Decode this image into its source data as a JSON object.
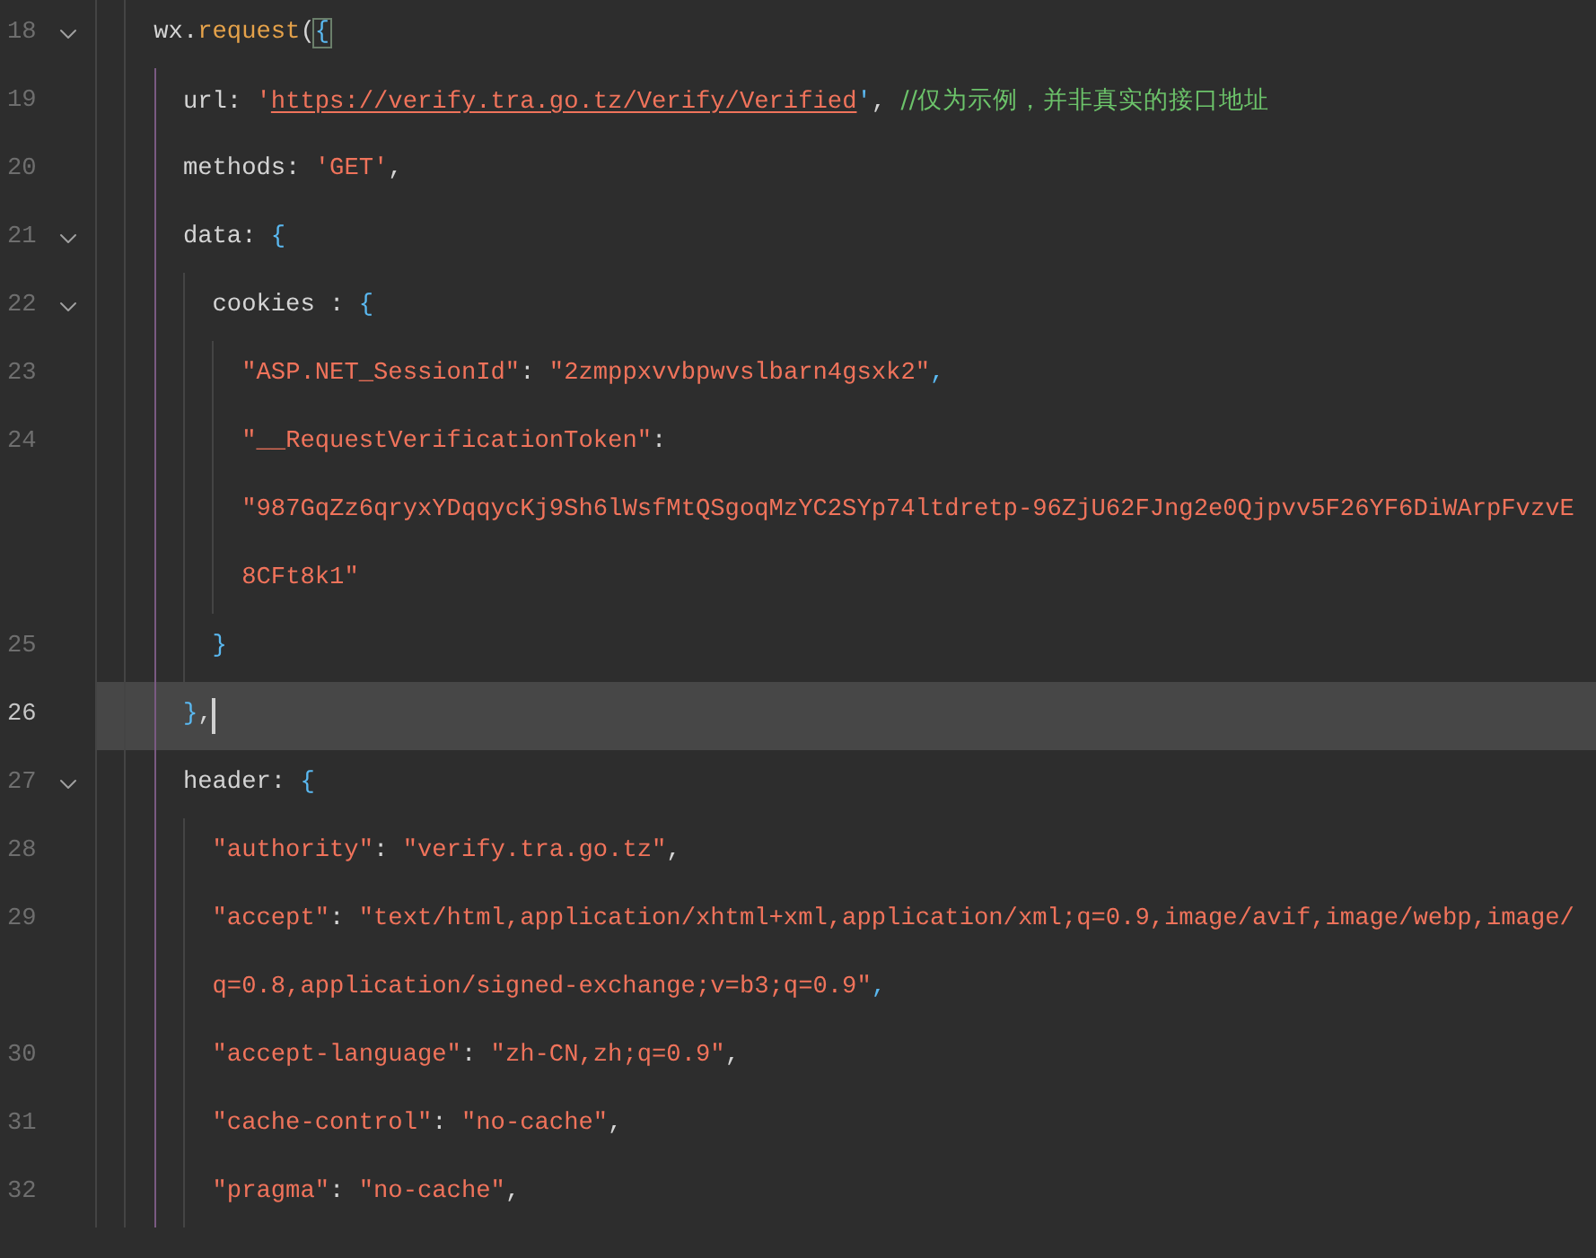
{
  "editor": {
    "lines": [
      {
        "number": "18",
        "foldable": true,
        "current": false,
        "tokens": [
          {
            "kind": "plain",
            "text": "wx."
          },
          {
            "kind": "func",
            "text": "request"
          },
          {
            "kind": "plain",
            "text": "("
          },
          {
            "kind": "matched-brace",
            "text": "{"
          }
        ],
        "children": [
          {
            "number": "19",
            "foldable": false,
            "current": false,
            "tokens": [
              {
                "kind": "plain",
                "text": "url: "
              },
              {
                "kind": "string",
                "text": "'"
              },
              {
                "kind": "link",
                "text": "https://verify.tra.go.tz/Verify/Verified"
              },
              {
                "kind": "brace",
                "text": "'"
              },
              {
                "kind": "plain",
                "text": ", "
              },
              {
                "kind": "comment",
                "text": "//仅为示例，并非真实的接口地址"
              }
            ]
          },
          {
            "number": "20",
            "foldable": false,
            "current": false,
            "tokens": [
              {
                "kind": "plain",
                "text": "methods: "
              },
              {
                "kind": "string",
                "text": "'GET'"
              },
              {
                "kind": "plain",
                "text": ","
              }
            ]
          },
          {
            "number": "21",
            "foldable": true,
            "current": false,
            "tokens": [
              {
                "kind": "plain",
                "text": "data: "
              },
              {
                "kind": "brace",
                "text": "{"
              }
            ],
            "children": [
              {
                "number": "22",
                "foldable": true,
                "current": false,
                "tokens": [
                  {
                    "kind": "plain",
                    "text": "cookies : "
                  },
                  {
                    "kind": "brace",
                    "text": "{"
                  }
                ],
                "children": [
                  {
                    "number": "23",
                    "foldable": false,
                    "current": false,
                    "tokens": [
                      {
                        "kind": "string",
                        "text": "\"ASP.NET_SessionId\""
                      },
                      {
                        "kind": "plain",
                        "text": ": "
                      },
                      {
                        "kind": "string",
                        "text": "\"2zmppxvvbpwvslbarn4gsxk2\""
                      },
                      {
                        "kind": "brace",
                        "text": ","
                      }
                    ]
                  },
                  {
                    "number": "24",
                    "foldable": false,
                    "current": false,
                    "tokens": [
                      {
                        "kind": "string",
                        "text": "\"__RequestVerificationToken\""
                      },
                      {
                        "kind": "plain",
                        "text": ":"
                      }
                    ],
                    "wrapped": [
                      [
                        {
                          "kind": "string",
                          "text": "\"987GqZz6qryxYDqqycKj9Sh6lWsfMtQSgoqMzYC2SYp74ltdretp-96ZjU62FJng2e0Qjpvv5F26YF6DiWArpFvzvE"
                        }
                      ],
                      [
                        {
                          "kind": "string",
                          "text": "8CFt8k1\""
                        }
                      ]
                    ]
                  }
                ]
              },
              {
                "number": "25",
                "foldable": false,
                "current": false,
                "tokens": [
                  {
                    "kind": "brace",
                    "text": "}"
                  }
                ]
              }
            ]
          },
          {
            "number": "26",
            "foldable": false,
            "current": true,
            "tokens": [
              {
                "kind": "brace",
                "text": "}"
              },
              {
                "kind": "plain",
                "text": ","
              }
            ]
          },
          {
            "number": "27",
            "foldable": true,
            "current": false,
            "tokens": [
              {
                "kind": "plain",
                "text": "header: "
              },
              {
                "kind": "brace",
                "text": "{"
              }
            ],
            "children": [
              {
                "number": "28",
                "foldable": false,
                "current": false,
                "tokens": [
                  {
                    "kind": "string",
                    "text": "\"authority\""
                  },
                  {
                    "kind": "plain",
                    "text": ": "
                  },
                  {
                    "kind": "string",
                    "text": "\"verify.tra.go.tz\""
                  },
                  {
                    "kind": "plain",
                    "text": ","
                  }
                ]
              },
              {
                "number": "29",
                "foldable": false,
                "current": false,
                "tokens": [
                  {
                    "kind": "string",
                    "text": "\"accept\""
                  },
                  {
                    "kind": "plain",
                    "text": ": "
                  },
                  {
                    "kind": "string",
                    "text": "\"text/html,application/xhtml+xml,application/xml;q=0.9,image/avif,image/webp,image/"
                  }
                ],
                "wrapped": [
                  [
                    {
                      "kind": "string",
                      "text": "q=0.8,application/signed-exchange;v=b3;q=0.9\""
                    },
                    {
                      "kind": "brace",
                      "text": ","
                    }
                  ]
                ]
              },
              {
                "number": "30",
                "foldable": false,
                "current": false,
                "tokens": [
                  {
                    "kind": "string",
                    "text": "\"accept-language\""
                  },
                  {
                    "kind": "plain",
                    "text": ": "
                  },
                  {
                    "kind": "string",
                    "text": "\"zh-CN,zh;q=0.9\""
                  },
                  {
                    "kind": "plain",
                    "text": ","
                  }
                ]
              },
              {
                "number": "31",
                "foldable": false,
                "current": false,
                "tokens": [
                  {
                    "kind": "string",
                    "text": "\"cache-control\""
                  },
                  {
                    "kind": "plain",
                    "text": ": "
                  },
                  {
                    "kind": "string",
                    "text": "\"no-cache\""
                  },
                  {
                    "kind": "plain",
                    "text": ","
                  }
                ]
              },
              {
                "number": "32",
                "foldable": false,
                "current": false,
                "tokens": [
                  {
                    "kind": "string",
                    "text": "\"pragma\""
                  },
                  {
                    "kind": "plain",
                    "text": ": "
                  },
                  {
                    "kind": "string",
                    "text": "\"no-cache\""
                  },
                  {
                    "kind": "plain",
                    "text": ","
                  }
                ]
              }
            ]
          }
        ]
      }
    ]
  }
}
